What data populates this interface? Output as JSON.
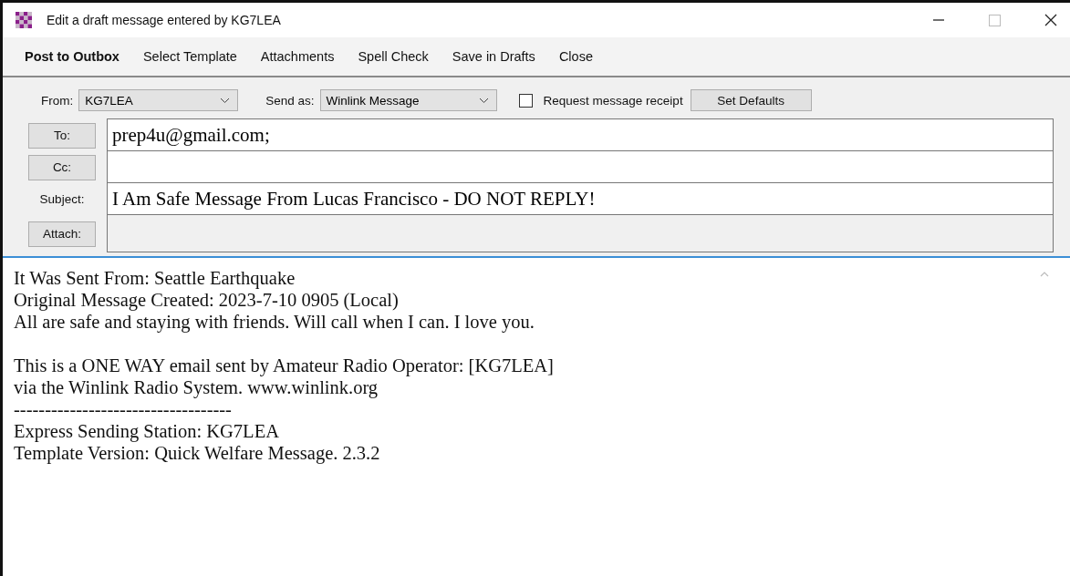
{
  "window": {
    "title": "Edit a draft message entered by KG7LEA"
  },
  "menu": [
    {
      "label": "Post to Outbox",
      "bold": true
    },
    {
      "label": "Select Template",
      "bold": false
    },
    {
      "label": "Attachments",
      "bold": false
    },
    {
      "label": "Spell Check",
      "bold": false
    },
    {
      "label": "Save in Drafts",
      "bold": false
    },
    {
      "label": "Close",
      "bold": false
    }
  ],
  "options": {
    "from_label": "From:",
    "from_value": "KG7LEA",
    "send_as_label": "Send as:",
    "send_as_value": "Winlink Message",
    "receipt": {
      "label": "Request message receipt",
      "checked": false
    },
    "defaults_button": "Set Defaults"
  },
  "fields": [
    {
      "label": "To:",
      "kind": "button",
      "value": "prep4u@gmail.com;",
      "disabled": false
    },
    {
      "label": "Cc:",
      "kind": "button",
      "disabled": false
    },
    {
      "label": "Subject:",
      "kind": "label",
      "value": "I Am Safe Message From Lucas Francisco - DO NOT REPLY!",
      "disabled": false
    },
    {
      "label": "Attach:",
      "kind": "button",
      "disabled": true
    }
  ],
  "body": {
    "paragraphs": [
      [
        "It Was Sent From: Seattle Earthquake",
        "Original Message Created: 2023-7-10 0905 (Local)",
        "All are safe and staying with friends. Will call when I can. I love you."
      ],
      [
        "This is a ONE WAY email sent by Amateur Radio Operator: [KG7LEA]",
        "via the Winlink Radio System.   www.winlink.org",
        "-----------------------------------",
        "Express Sending Station: KG7LEA",
        "Template Version: Quick Welfare Message. 2.3.2"
      ]
    ]
  }
}
